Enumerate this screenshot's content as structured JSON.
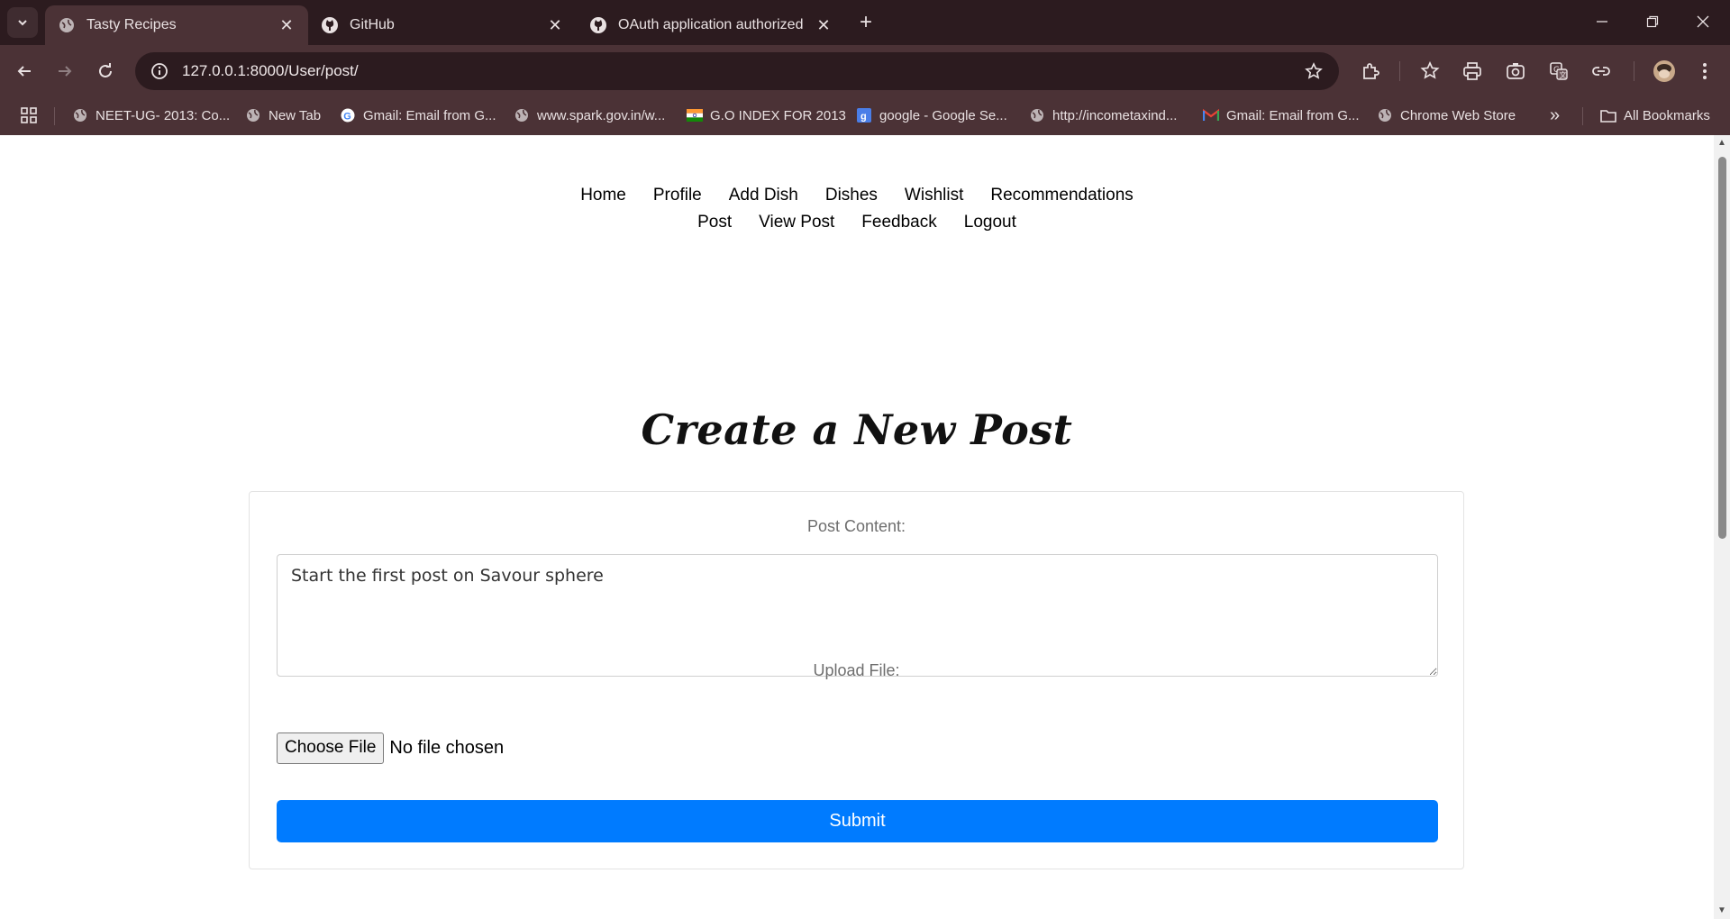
{
  "browser": {
    "tabs": [
      {
        "title": "Tasty Recipes",
        "icon": "globe-icon",
        "active": true
      },
      {
        "title": "GitHub",
        "icon": "github-icon",
        "active": false
      },
      {
        "title": "OAuth application authorized",
        "icon": "github-icon",
        "active": false
      }
    ],
    "url": "127.0.0.1:8000/User/post/",
    "bookmarks": [
      {
        "label": "NEET-UG- 2013: Co...",
        "icon": "globe-icon"
      },
      {
        "label": "New Tab",
        "icon": "globe-icon"
      },
      {
        "label": "Gmail: Email from G...",
        "icon": "google-icon"
      },
      {
        "label": "www.spark.gov.in/w...",
        "icon": "globe-icon"
      },
      {
        "label": "G.O INDEX FOR 2013",
        "icon": "flag-icon"
      },
      {
        "label": "google - Google Se...",
        "icon": "google-search-icon"
      },
      {
        "label": "http://incometaxind...",
        "icon": "globe-icon"
      },
      {
        "label": "Gmail: Email from G...",
        "icon": "gmail-icon"
      },
      {
        "label": "Chrome Web Store",
        "icon": "globe-icon"
      }
    ],
    "all_bookmarks": "All Bookmarks",
    "overflow": "»"
  },
  "nav": {
    "row1": [
      "Home",
      "Profile",
      "Add Dish",
      "Dishes",
      "Wishlist",
      "Recommendations"
    ],
    "row2": [
      "Post",
      "View Post",
      "Feedback",
      "Logout"
    ]
  },
  "form": {
    "heading": "Create a New Post",
    "content_label": "Post Content:",
    "content_value": "Start the first post on Savour sphere",
    "upload_label": "Upload File:",
    "choose_file": "Choose File",
    "file_status": "No file chosen",
    "submit": "Submit"
  },
  "colors": {
    "submit": "#007bff",
    "chrome_dark": "#2c1b1f",
    "chrome_mid": "#4b3236"
  }
}
